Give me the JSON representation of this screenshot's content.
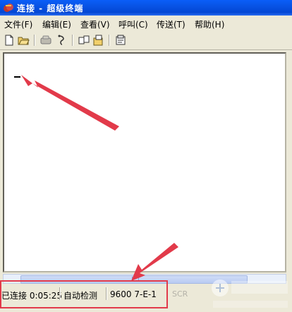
{
  "window": {
    "title": "连接 - 超级终端"
  },
  "menu": [
    {
      "label": "文件(F)"
    },
    {
      "label": "编辑(E)"
    },
    {
      "label": "查看(V)"
    },
    {
      "label": "呼叫(C)"
    },
    {
      "label": "传送(T)"
    },
    {
      "label": "帮助(H)"
    }
  ],
  "toolbar": {
    "icons": [
      "new-file-icon",
      "open-folder-icon",
      "phone-icon",
      "disconnect-icon",
      "send-icon",
      "receive-icon",
      "properties-icon"
    ]
  },
  "terminal": {
    "cursor": "_"
  },
  "statusbar": {
    "connection": "已连接 0:05:25",
    "detect": "自动检测",
    "port_settings": "9600 7-E-1",
    "faint_indicator": "SCR"
  },
  "colors": {
    "titlebar": "#0a5ef8",
    "annotation": "#e23a4a",
    "terminal_bg": "#ffffff",
    "chrome": "#ece9d8"
  }
}
